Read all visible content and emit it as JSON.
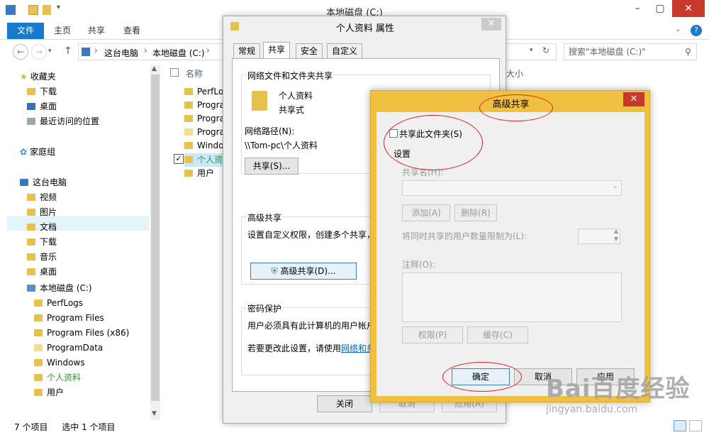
{
  "explorer": {
    "window_title": "本地磁盘 (C:)",
    "ribbon_tabs": [
      "文件",
      "主页",
      "共享",
      "查看"
    ],
    "breadcrumb": [
      "这台电脑",
      "本地磁盘 (C:)"
    ],
    "search_placeholder": "搜索\"本地磁盘 (C:)\"",
    "column_name": "名称",
    "column_size_partial": "大小",
    "nav": {
      "favorites": "收藏夹",
      "fav_items": [
        "下载",
        "桌面",
        "最近访问的位置"
      ],
      "homegroup": "家庭组",
      "this_pc": "这台电脑",
      "pc_items": [
        "视频",
        "图片",
        "文档",
        "下载",
        "音乐",
        "桌面"
      ],
      "drive": "本地磁盘 (C:)",
      "drive_items": [
        "PerfLogs",
        "Program Files",
        "Program Files (x86)",
        "ProgramData",
        "Windows",
        "个人资料",
        "用户"
      ]
    },
    "files": [
      "PerfLo",
      "Progra",
      "Progra",
      "Progra",
      "Windo",
      "个人资",
      "用户"
    ],
    "status": {
      "count": "7 个项目",
      "selected": "选中 1 个项目"
    },
    "accent": "#1979ca"
  },
  "props": {
    "title": "个人资料 属性",
    "tabs": [
      "常规",
      "共享",
      "安全",
      "自定义"
    ],
    "net_group_title": "网络文件和文件夹共享",
    "folder_name": "个人资料",
    "folder_state": "共享式",
    "path_label": "网络路径(N):",
    "path_value": "\\\\Tom-pc\\个人资料",
    "share_button": "共享(S)...",
    "adv_group_title": "高级共享",
    "adv_desc": "设置自定义权限，创建多个共享，并",
    "adv_button": "高级共享(D)...",
    "pwd_group_title": "密码保护",
    "pwd_desc": "用户必须具有此计算机的用户帐户和",
    "pwd_change": "若要更改此设置，请使用",
    "pwd_link": "网络和共享",
    "close_button": "关闭",
    "cancel_button": "取消",
    "apply_button": "应用(A)"
  },
  "adv": {
    "title": "高级共享",
    "share_checkbox": "共享此文件夹(S)",
    "settings_label": "设置",
    "share_name_label": "共享名(H):",
    "add_button": "添加(A)",
    "remove_button": "删除(R)",
    "limit_label": "将同时共享的用户数量限制为(L):",
    "comment_label": "注释(O):",
    "permissions_button": "权限(P)",
    "cache_button": "缓存(C)",
    "ok_button": "确定",
    "cancel_button": "取消",
    "apply_button": "应用",
    "checked": false
  },
  "watermark": {
    "brand": "Bai百度经验",
    "url": "jingyan.baidu.com"
  }
}
